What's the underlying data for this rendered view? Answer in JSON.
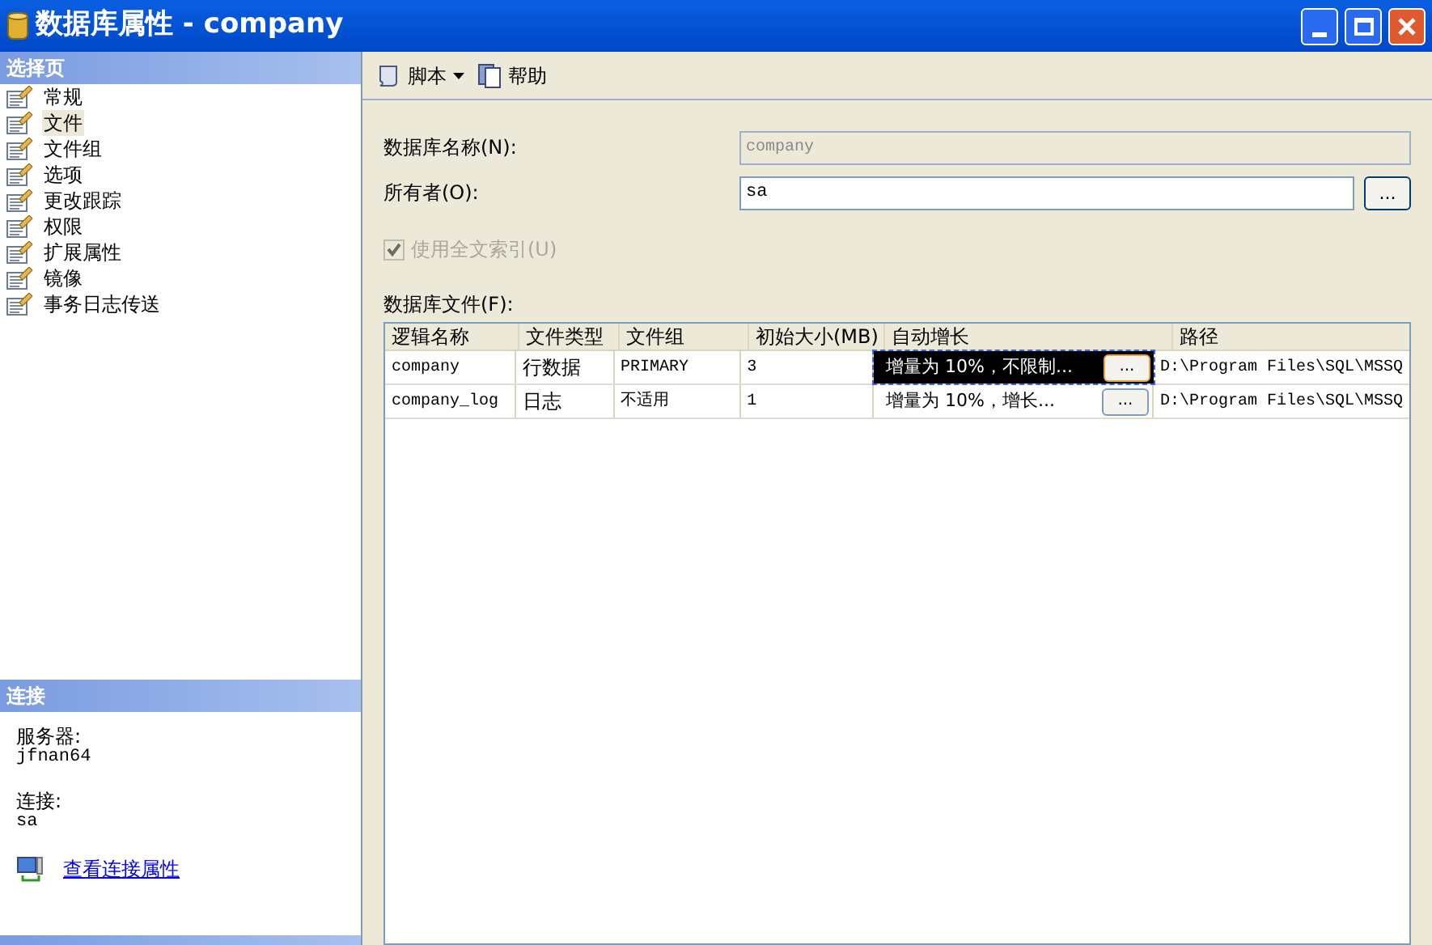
{
  "window": {
    "title": "数据库属性 - company"
  },
  "sidebar": {
    "title": "选择页",
    "items": [
      {
        "label": "常规",
        "selected": false
      },
      {
        "label": "文件",
        "selected": true
      },
      {
        "label": "文件组",
        "selected": false
      },
      {
        "label": "选项",
        "selected": false
      },
      {
        "label": "更改跟踪",
        "selected": false
      },
      {
        "label": "权限",
        "selected": false
      },
      {
        "label": "扩展属性",
        "selected": false
      },
      {
        "label": "镜像",
        "selected": false
      },
      {
        "label": "事务日志传送",
        "selected": false
      }
    ]
  },
  "connection": {
    "title": "连接",
    "server_label": "服务器:",
    "server": "jfnan64",
    "connection_label": "连接:",
    "connection": "sa",
    "link": "查看连接属性"
  },
  "toolbar": {
    "script": "脚本",
    "help": "帮助"
  },
  "form": {
    "name_label": "数据库名称(N):",
    "name": "company",
    "owner_label": "所有者(O):",
    "owner": "sa",
    "browse": "...",
    "fulltext": {
      "label": "使用全文索引(U)",
      "checked": true,
      "disabled": true
    }
  },
  "files": {
    "label": "数据库文件(F):",
    "columns": [
      "逻辑名称",
      "文件类型",
      "文件组",
      "初始大小(MB)",
      "自动增长",
      "路径"
    ],
    "rows": [
      {
        "name": "company",
        "type": "行数据",
        "group": "PRIMARY",
        "size": "3",
        "growth": "增量为 10%，不限制...",
        "editing": true,
        "button": "...",
        "path": "D:\\Program Files\\SQL\\MSSQ"
      },
      {
        "name": "company_log",
        "type": "日志",
        "group": "不适用",
        "size": "1",
        "growth": "增量为 10%，增长...",
        "editing": false,
        "button": "...",
        "path": "D:\\Program Files\\SQL\\MSSQ"
      }
    ]
  }
}
